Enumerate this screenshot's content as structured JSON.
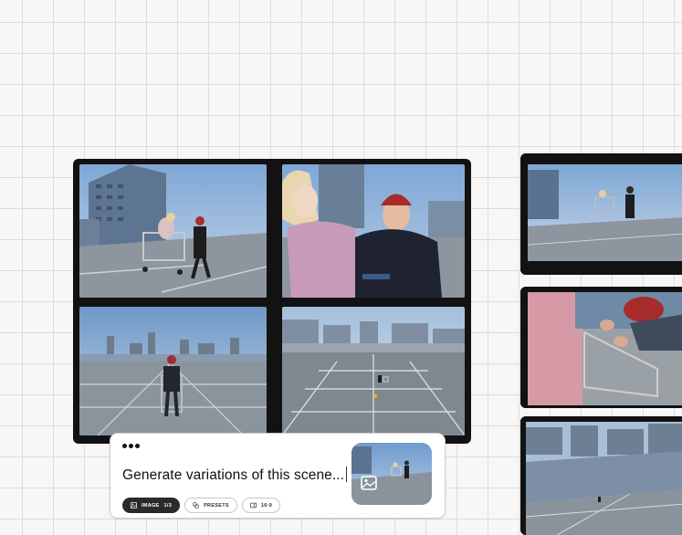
{
  "prompt_card": {
    "prompt_text": "Generate variations of this scene...",
    "chips": [
      {
        "label": "IMAGE",
        "count": "1/3",
        "icon": "image-icon"
      },
      {
        "label": "PRESETS",
        "icon": "presets-icon"
      },
      {
        "label": "16:9",
        "icon": "aspect-ratio-icon"
      }
    ],
    "more_icon": "more-dots-icon",
    "thumbnail_icon": "image-icon"
  },
  "palette": {
    "sky": "#a9c4e0",
    "pavement": "#8a939c",
    "frame": "#121212",
    "grid": "#dcdcdc"
  }
}
